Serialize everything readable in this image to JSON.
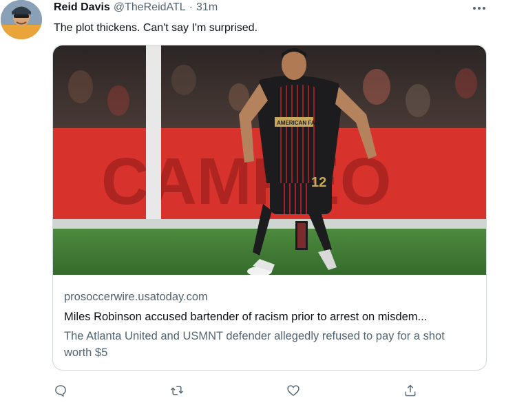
{
  "tweet": {
    "author_name": "Reid Davis",
    "handle": "@TheReidATL",
    "separator": "·",
    "time": "31m",
    "text": "The plot thickens. Can't say I'm surprised.",
    "more_icon": "more-horizontal-icon"
  },
  "card": {
    "domain": "prosoccerwire.usatoday.com",
    "title": "Miles Robinson accused bartender of racism prior to arrest on misdem...",
    "description": "The Atlanta United and USMNT defender allegedly refused to pay for a shot worth $5",
    "image_jersey_sponsor": "AMERICAN FAMILY",
    "image_jersey_number": "12",
    "image_banner_text": "CAMPEO"
  },
  "actions": [
    {
      "name": "reply-icon"
    },
    {
      "name": "retweet-icon"
    },
    {
      "name": "like-icon"
    },
    {
      "name": "share-icon"
    }
  ],
  "colors": {
    "text_primary": "#0f1419",
    "text_secondary": "#536471",
    "border": "#cfd9de",
    "banner_red": "#d8322c",
    "pitch_green": "#3f7a34",
    "jersey_black": "#1c1c1e",
    "jersey_red": "#a5202a"
  }
}
